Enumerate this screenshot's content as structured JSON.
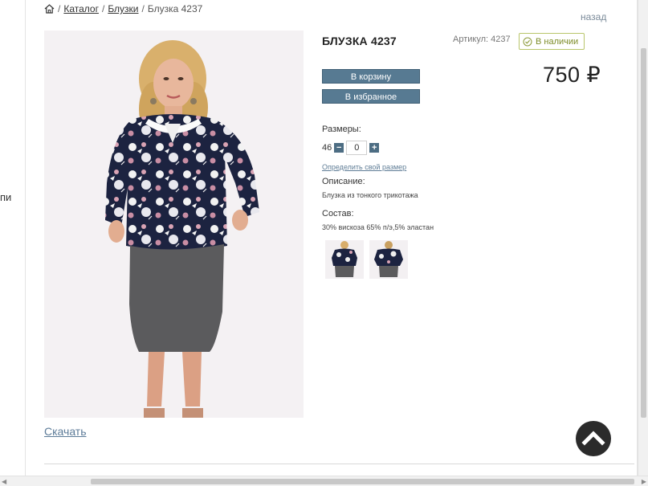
{
  "left_cut_text": "пи",
  "breadcrumb": {
    "home_icon": "home-icon",
    "sep1": "/",
    "catalog": "Каталог",
    "sep2": "/",
    "blouses": "Блузки",
    "sep3": "/",
    "current": "Блузка 4237"
  },
  "back_link": "назад",
  "product": {
    "title": "БЛУЗКА 4237",
    "sku": "Артикул: 4237",
    "stock": "В наличии",
    "price": "750 ₽",
    "add_to_cart": "В корзину",
    "add_to_favorites": "В избранное",
    "sizes_label": "Размеры:",
    "size_value": "46",
    "qty_value": "0",
    "size_link": "Определить свой размер",
    "description_label": "Описание:",
    "description_text": "Блузка из тонкого трикотажа",
    "composition_label": "Состав:",
    "composition_text": "30% вискоза 65% п/э,5% эластан",
    "download": "Скачать"
  },
  "colors": {
    "button": "#577a92",
    "link": "#5c7b98",
    "stock_border": "#b9c56b",
    "stock_text": "#7d8c28",
    "scroll_up_bg": "#2b2b2b"
  },
  "icons": {
    "minus": "−",
    "plus": "+",
    "scroll_up": "chevron-up-icon",
    "stock": "check-circle-icon"
  }
}
